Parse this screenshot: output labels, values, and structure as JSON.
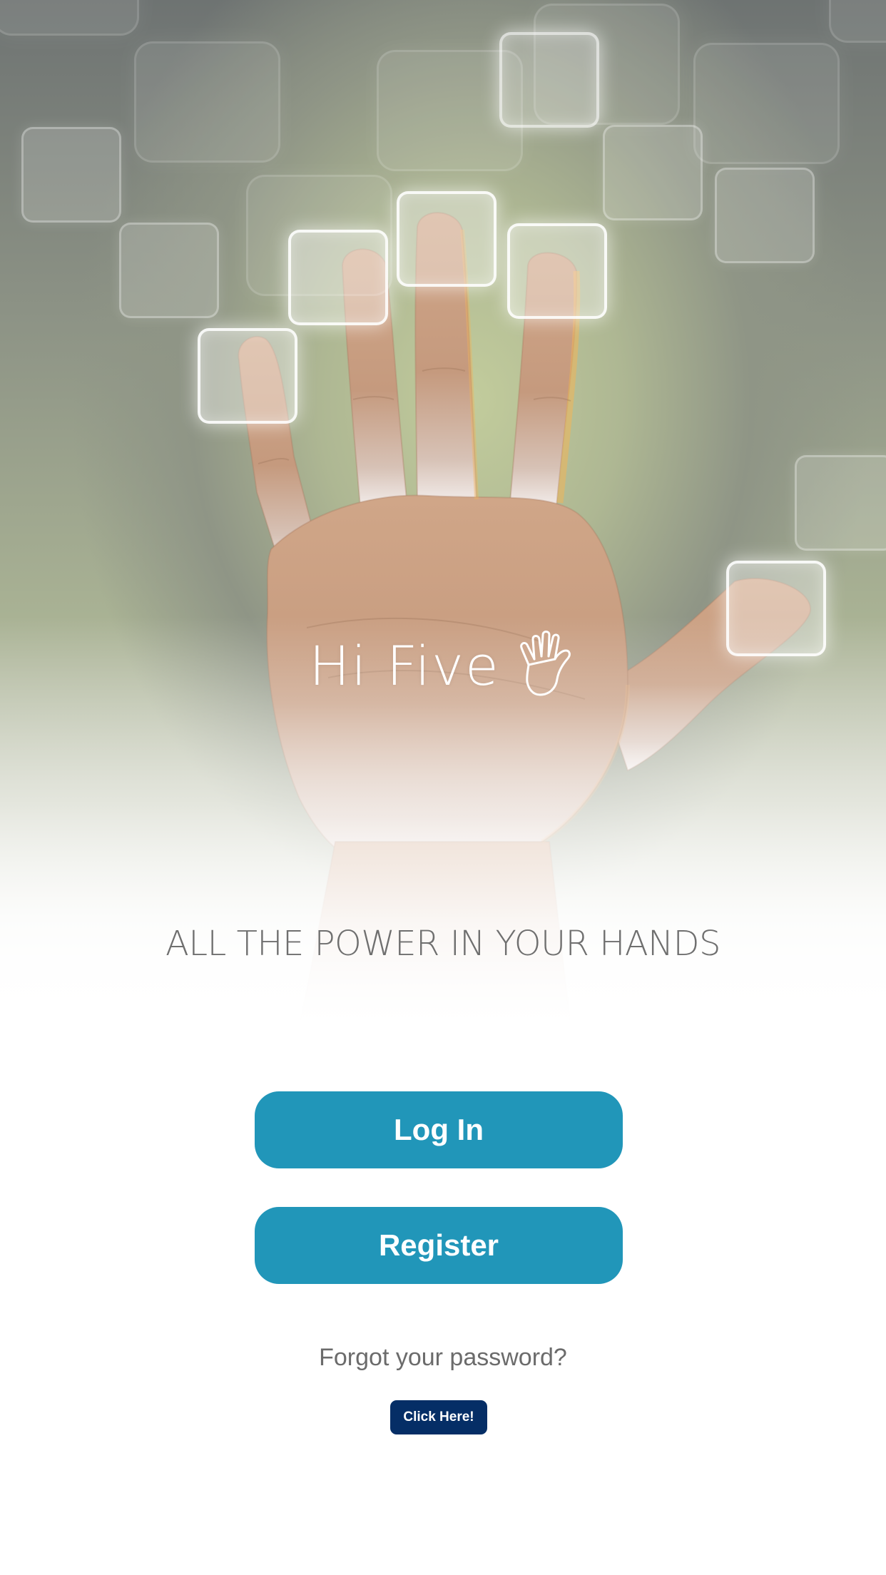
{
  "brand": {
    "name": "Hi Five",
    "icon": "waving-hand-outline-icon"
  },
  "tagline": "ALL THE POWER IN YOUR HANDS",
  "actions": {
    "login_label": "Log In",
    "register_label": "Register"
  },
  "password_recovery": {
    "prompt": "Forgot your password?",
    "link_label": "Click Here!"
  },
  "colors": {
    "primary_button": "#2196b9",
    "link_button": "#052e66",
    "tagline_text": "#6f6f6f",
    "background": "#ffffff"
  }
}
